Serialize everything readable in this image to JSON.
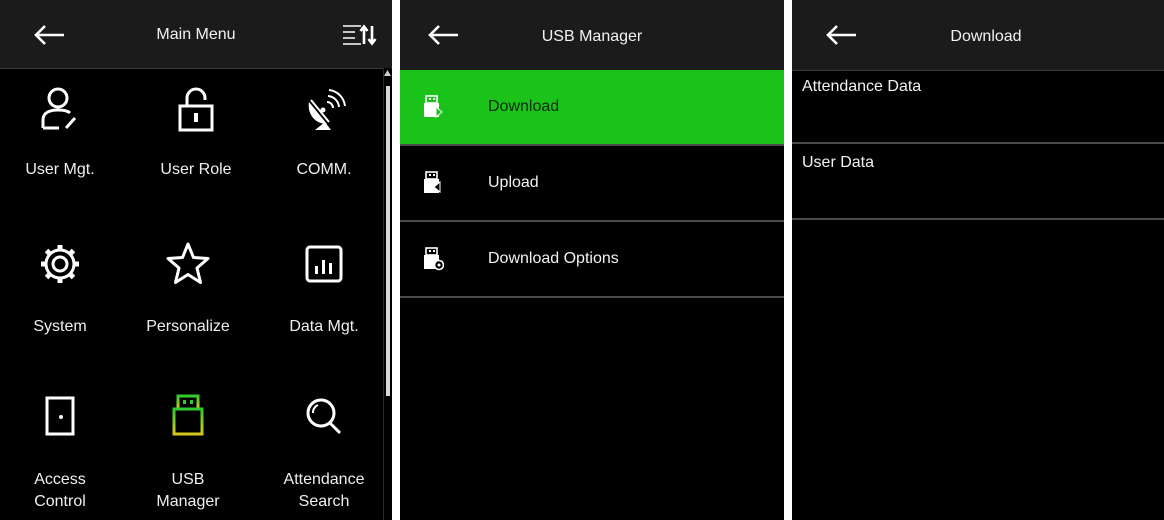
{
  "main_menu": {
    "title": "Main Menu",
    "items": [
      {
        "label_lines": [
          "User Mgt."
        ],
        "icon": "user-icon"
      },
      {
        "label_lines": [
          "User Role"
        ],
        "icon": "lock-icon"
      },
      {
        "label_lines": [
          "COMM."
        ],
        "icon": "satellite-dish-icon"
      },
      {
        "label_lines": [
          "System"
        ],
        "icon": "gear-icon"
      },
      {
        "label_lines": [
          "Personalize"
        ],
        "icon": "star-icon"
      },
      {
        "label_lines": [
          "Data Mgt."
        ],
        "icon": "bar-chart-icon"
      },
      {
        "label_lines": [
          "Access",
          "Control"
        ],
        "icon": "door-icon"
      },
      {
        "label_lines": [
          "USB",
          "Manager"
        ],
        "icon": "usb-drive-icon",
        "highlight_color": "#c8d21e"
      },
      {
        "label_lines": [
          "Attendance",
          "Search"
        ],
        "icon": "magnifier-icon"
      }
    ]
  },
  "usb_manager": {
    "title": "USB Manager",
    "items": [
      {
        "label": "Download",
        "icon": "usb-download-icon",
        "selected": true
      },
      {
        "label": "Upload",
        "icon": "usb-upload-icon",
        "selected": false
      },
      {
        "label": "Download Options",
        "icon": "usb-settings-icon",
        "selected": false
      }
    ]
  },
  "download": {
    "title": "Download",
    "items": [
      {
        "label": "Attendance Data"
      },
      {
        "label": "User Data"
      }
    ]
  },
  "colors": {
    "selected_row": "#1ac21a",
    "background": "#000000",
    "header": "#1b1b1b",
    "usb_icon_green": "#2ecc2e",
    "usb_icon_yellow": "#c8d21e"
  }
}
